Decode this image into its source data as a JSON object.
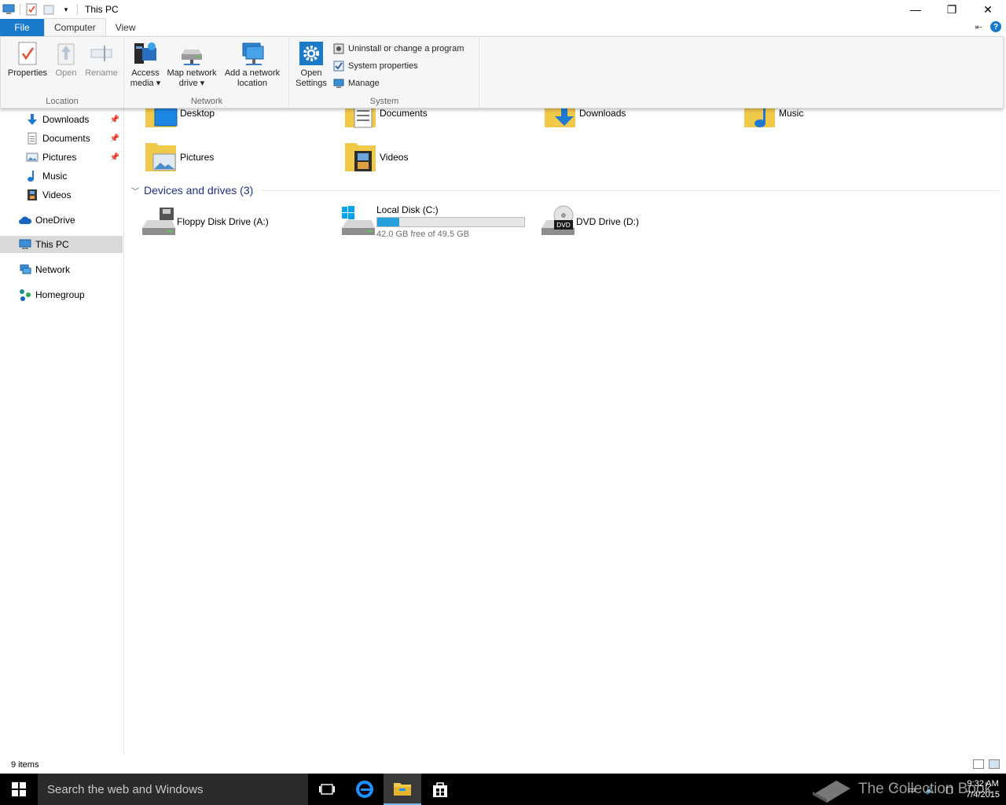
{
  "window": {
    "title": "This PC",
    "controls": {
      "minimize": "—",
      "restore": "❐",
      "close": "✕"
    }
  },
  "ribbon_tabs": [
    {
      "label": "File"
    },
    {
      "label": "Computer"
    },
    {
      "label": "View"
    }
  ],
  "ribbon": {
    "location": {
      "label": "Location",
      "properties": "Properties",
      "open": "Open",
      "rename": "Rename"
    },
    "network": {
      "label": "Network",
      "access_media_1": "Access",
      "access_media_2": "media ▾",
      "map_drive_1": "Map network",
      "map_drive_2": "drive ▾",
      "add_location_1": "Add a network",
      "add_location_2": "location"
    },
    "system": {
      "label": "System",
      "open_settings_1": "Open",
      "open_settings_2": "Settings",
      "uninstall": "Uninstall or change a program",
      "system_properties": "System properties",
      "manage": "Manage"
    }
  },
  "nav": {
    "downloads": "Downloads",
    "documents": "Documents",
    "pictures": "Pictures",
    "music": "Music",
    "videos": "Videos",
    "onedrive": "OneDrive",
    "this_pc": "This PC",
    "network": "Network",
    "homegroup": "Homegroup"
  },
  "folders": {
    "desktop": "Desktop",
    "documents": "Documents",
    "downloads": "Downloads",
    "music": "Music",
    "pictures": "Pictures",
    "videos": "Videos"
  },
  "devices": {
    "header": "Devices and drives (3)",
    "floppy": "Floppy Disk Drive (A:)",
    "local_disk": "Local Disk (C:)",
    "local_disk_free": "42.0 GB free of 49.5 GB",
    "local_disk_used_fraction": 0.152,
    "dvd": "DVD Drive (D:)"
  },
  "status": {
    "items": "9 items"
  },
  "taskbar": {
    "search_placeholder": "Search the web and Windows",
    "watermark": "The Collection Book",
    "time": "9:32 AM",
    "date": "7/4/2015"
  },
  "colors": {
    "accent": "#1979ca",
    "drive_bar": "#26a0da",
    "folder": "#f0c94b",
    "group_header": "#1e3287"
  }
}
